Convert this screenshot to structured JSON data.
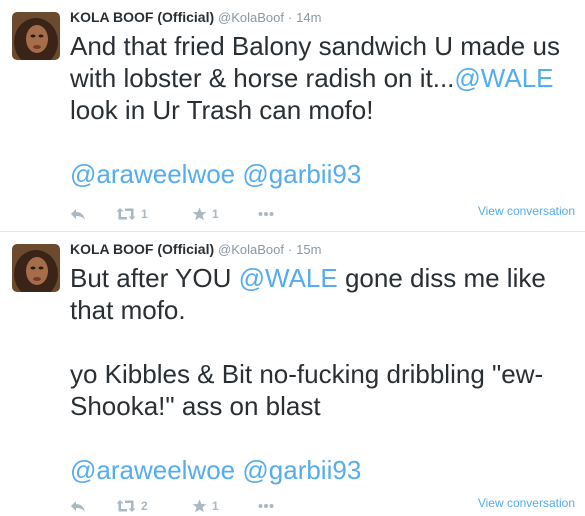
{
  "tweets": [
    {
      "fullname": "KOLA BOOF (Official)",
      "username": "@KolaBoof",
      "separator": "·",
      "time": "14m",
      "paragraphs": [
        [
          {
            "text": "And that fried Balony sandwich U made us with lobster & horse radish on it..."
          },
          {
            "text": "@WALE",
            "mention": true
          },
          {
            "text": " look in Ur Trash can mofo!"
          }
        ],
        [
          {
            "text": "@araweelwoe",
            "mention": true
          },
          {
            "text": " "
          },
          {
            "text": "@garbii93",
            "mention": true
          }
        ]
      ],
      "retweet_count": "1",
      "favorite_count": "1",
      "view_conversation": "View conversation"
    },
    {
      "fullname": "KOLA BOOF (Official)",
      "username": "@KolaBoof",
      "separator": "·",
      "time": "15m",
      "paragraphs": [
        [
          {
            "text": "But after YOU "
          },
          {
            "text": "@WALE",
            "mention": true
          },
          {
            "text": " gone diss me like that mofo."
          }
        ],
        [
          {
            "text": "yo Kibbles & Bit no-fucking dribbling \"ew-Shooka!\" ass on blast"
          }
        ],
        [
          {
            "text": "@araweelwoe",
            "mention": true
          },
          {
            "text": " "
          },
          {
            "text": "@garbii93",
            "mention": true
          }
        ]
      ],
      "retweet_count": "2",
      "favorite_count": "1",
      "view_conversation": "View conversation"
    }
  ],
  "icons": {
    "reply": "reply-icon",
    "retweet": "retweet-icon",
    "favorite": "star-icon",
    "more": "more-icon"
  },
  "colors": {
    "link": "#55acee",
    "text": "#292f33",
    "muted": "#8899a6",
    "action": "#aab8c2"
  }
}
